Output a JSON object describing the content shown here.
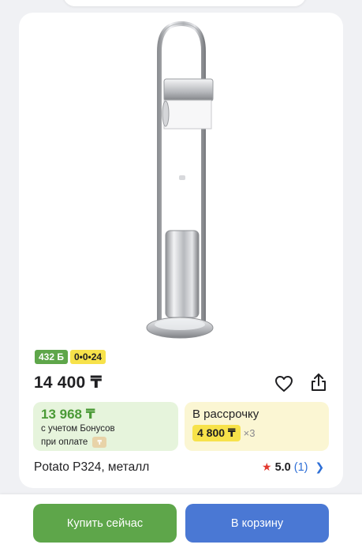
{
  "product": {
    "name": "Potato P324, металл",
    "price": "14 400 ₸",
    "image_icon": "towel-stand-brush-holder-image"
  },
  "badges": {
    "bonus": "432 Б",
    "installment": "0•0•24"
  },
  "bonus_offer": {
    "price": "13 968 ₸",
    "note_line1": "с учетом Бонусов",
    "note_line2": "при оплате",
    "icon": "payment-card-icon"
  },
  "installment_offer": {
    "title": "В рассрочку",
    "amount": "4 800 ₸",
    "multiplier": "×3"
  },
  "rating": {
    "value": "5.0",
    "count": "(1)"
  },
  "actions": {
    "buy_now": "Купить сейчас",
    "add_to_cart": "В корзину"
  },
  "colors": {
    "green": "#5ea64a",
    "blue": "#4a78d4",
    "yellow": "#f7e24a",
    "star": "#e2382e"
  }
}
